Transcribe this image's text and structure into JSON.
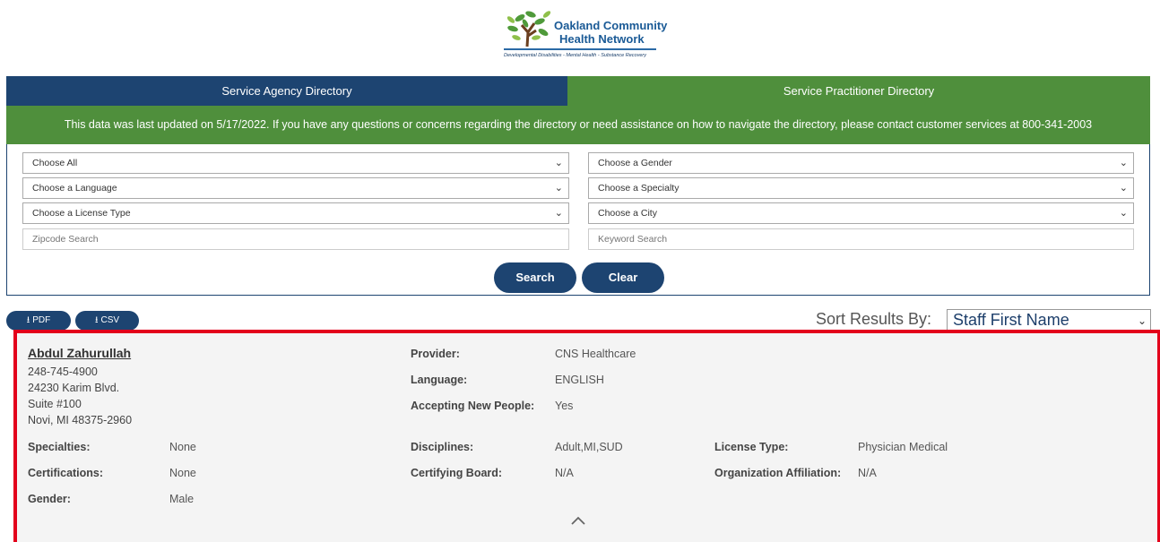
{
  "logo": {
    "org_line1": "Oakland Community",
    "org_line2": "Health Network",
    "tagline": "Developmental Disabilities - Mental Health - Substance Recovery"
  },
  "tabs": [
    {
      "label": "Service Agency Directory"
    },
    {
      "label": "Service Practitioner Directory"
    }
  ],
  "notice": "This data was last updated on 5/17/2022. If you have any questions or concerns regarding the directory or need assistance on how to navigate the directory, please contact customer services at 800-341-2003",
  "filters": {
    "choose_all": "Choose All",
    "language": "Choose a Language",
    "license": "Choose a License Type",
    "zipcode_placeholder": "Zipcode Search",
    "gender": "Choose a Gender",
    "specialty": "Choose a Specialty",
    "city": "Choose a City",
    "keyword_placeholder": "Keyword Search"
  },
  "buttons": {
    "search": "Search",
    "clear": "Clear"
  },
  "downloads": {
    "pdf": "PDF",
    "csv": "CSV"
  },
  "sort": {
    "label": "Sort Results By:",
    "value": "Staff First Name"
  },
  "result": {
    "name": "Abdul Zahurullah",
    "phone": "248-745-4900",
    "address1": "24230 Karim Blvd.",
    "address2": "Suite #100",
    "address3": "Novi, MI 48375-2960",
    "provider_label": "Provider:",
    "provider": "CNS Healthcare",
    "language_label": "Language:",
    "language": "ENGLISH",
    "accepting_label": "Accepting New People:",
    "accepting": "Yes",
    "specialties_label": "Specialties:",
    "specialties": "None",
    "disciplines_label": "Disciplines:",
    "disciplines": "Adult,MI,SUD",
    "license_label": "License Type:",
    "license": "Physician Medical",
    "certifications_label": "Certifications:",
    "certifications": "None",
    "board_label": "Certifying Board:",
    "board": "N/A",
    "affiliation_label": "Organization Affiliation:",
    "affiliation": "N/A",
    "gender_label": "Gender:",
    "gender": "Male"
  }
}
